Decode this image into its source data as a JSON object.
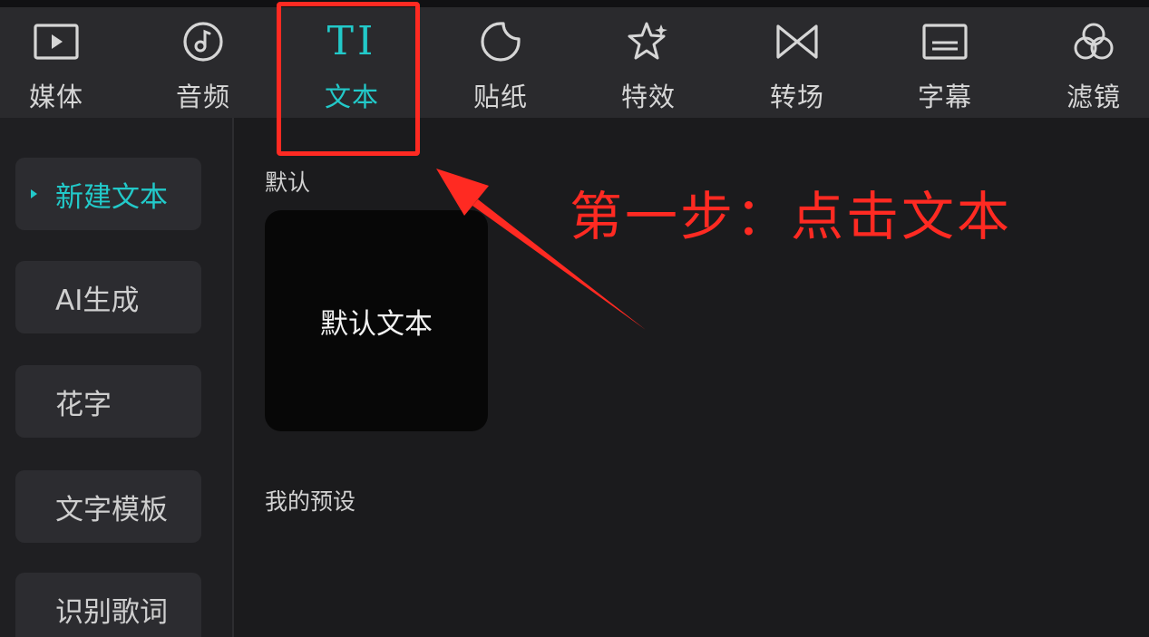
{
  "toolbar": {
    "tools": [
      {
        "label": "媒体",
        "icon": "media-icon"
      },
      {
        "label": "音频",
        "icon": "audio-icon"
      },
      {
        "label": "文本",
        "icon": "text-icon",
        "glyph": "TI"
      },
      {
        "label": "贴纸",
        "icon": "sticker-icon"
      },
      {
        "label": "特效",
        "icon": "effects-icon"
      },
      {
        "label": "转场",
        "icon": "transition-icon"
      },
      {
        "label": "字幕",
        "icon": "subtitle-icon"
      },
      {
        "label": "滤镜",
        "icon": "filter-icon"
      }
    ]
  },
  "sidebar": {
    "items": [
      {
        "label": "新建文本"
      },
      {
        "label": "AI生成"
      },
      {
        "label": "花字"
      },
      {
        "label": "文字模板"
      },
      {
        "label": "识别歌词"
      }
    ]
  },
  "main": {
    "default_section": {
      "title": "默认"
    },
    "default_card": {
      "label": "默认文本"
    },
    "presets_section": {
      "title": "我的预设"
    }
  },
  "annotation": {
    "text": "第一步：点击文本"
  },
  "colors": {
    "accent": "#22c9c9",
    "annotation": "#ff2a22",
    "toolbar_bg": "#2a2a2d",
    "panel_bg": "#1b1b1d"
  }
}
